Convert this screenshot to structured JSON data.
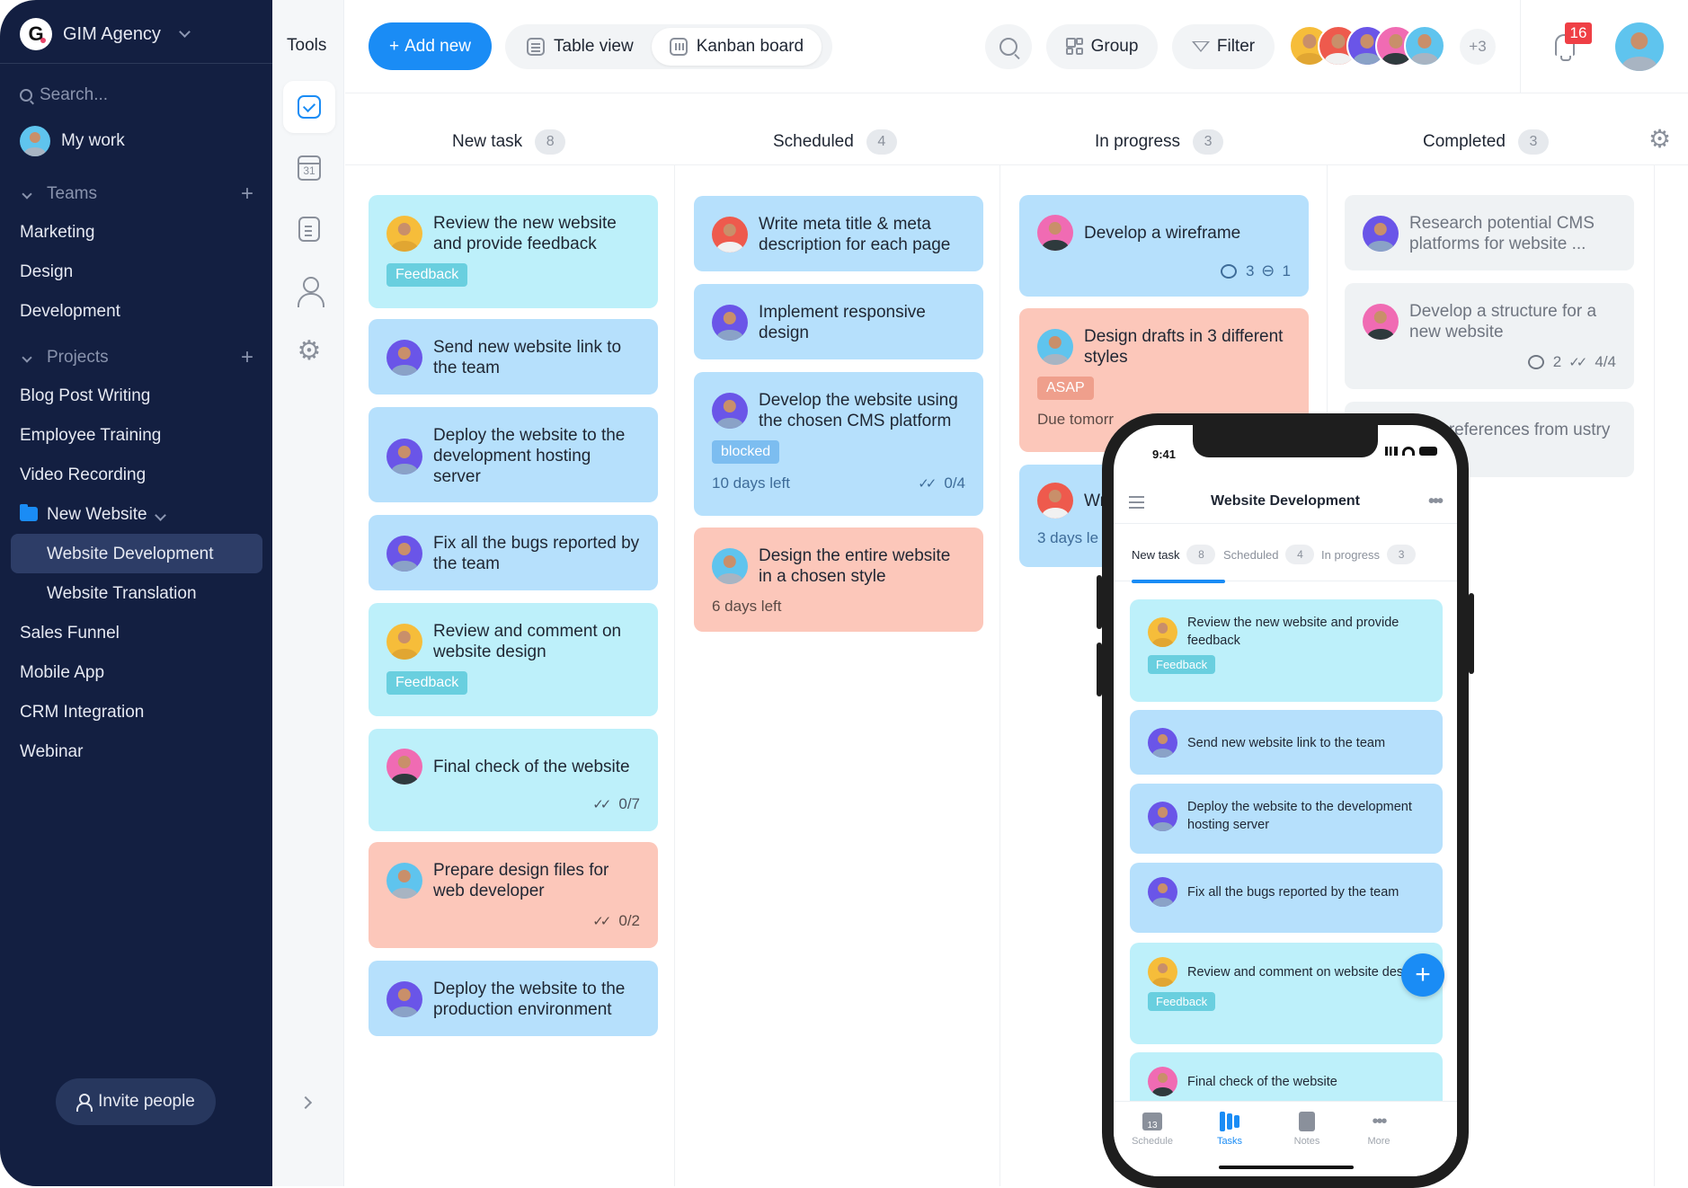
{
  "sidebar": {
    "workspace": "GIM Agency",
    "logo_letter": "G",
    "search_placeholder": "Search...",
    "my_work": "My work",
    "teams_label": "Teams",
    "teams": [
      "Marketing",
      "Design",
      "Development"
    ],
    "projects_label": "Projects",
    "projects": [
      "Blog Post Writing",
      "Employee Training",
      "Video Recording"
    ],
    "folder": {
      "label": "New Website",
      "children": [
        "Website Development",
        "Website Translation"
      ],
      "active": "Website Development"
    },
    "projects_after": [
      "Sales Funnel",
      "Mobile App",
      "CRM Integration",
      "Webinar"
    ],
    "invite": "Invite people"
  },
  "tools": {
    "title": "Tools",
    "items": [
      {
        "icon": "tasks-icon",
        "active": true
      },
      {
        "icon": "calendar-icon",
        "label": "31"
      },
      {
        "icon": "notes-icon"
      },
      {
        "icon": "user-icon"
      },
      {
        "icon": "settings-icon"
      }
    ]
  },
  "toolbar": {
    "add_new": "Add new",
    "views": [
      "Table view",
      "Kanban board"
    ],
    "active_view": "Kanban board",
    "group": "Group",
    "filter": "Filter",
    "member_overflow": "+3",
    "notifications": "16"
  },
  "columns": [
    {
      "name": "New task",
      "count": "8",
      "cards": [
        {
          "title": "Review the new website and provide feedback",
          "avatar": "yellow",
          "color": "cyan",
          "tag": "Feedback"
        },
        {
          "title": "Send new website link to the team",
          "avatar": "purple",
          "color": "blue"
        },
        {
          "title": "Deploy the website to the development hosting server",
          "avatar": "purple",
          "color": "blue"
        },
        {
          "title": "Fix all the bugs reported by the team",
          "avatar": "purple",
          "color": "blue"
        },
        {
          "title": "Review and comment on website design",
          "avatar": "yellow",
          "color": "cyan",
          "tag": "Feedback"
        },
        {
          "title": "Final check of the website",
          "avatar": "pink",
          "color": "cyan",
          "checklist": "0/7"
        },
        {
          "title": "Prepare design files for web developer",
          "avatar": "blue",
          "color": "salmon",
          "checklist": "0/2"
        },
        {
          "title": "Deploy the website to the production environment",
          "avatar": "purple",
          "color": "blue"
        }
      ]
    },
    {
      "name": "Scheduled",
      "count": "4",
      "cards": [
        {
          "title": "Write meta title & meta description for each page",
          "avatar": "red",
          "color": "blue"
        },
        {
          "title": "Implement responsive design",
          "avatar": "purple",
          "color": "blue"
        },
        {
          "title": "Develop the website using the chosen CMS platform",
          "avatar": "purple",
          "color": "blue",
          "tag": "blocked",
          "due": "10 days left",
          "checklist": "0/4"
        },
        {
          "title": "Design the entire website in a chosen style",
          "avatar": "blue",
          "color": "salmon",
          "due": "6 days left"
        }
      ]
    },
    {
      "name": "In progress",
      "count": "3",
      "cards": [
        {
          "title": "Develop a wireframe",
          "avatar": "pink",
          "color": "blue",
          "comments": "3",
          "attachments": "1"
        },
        {
          "title": "Design drafts in 3 different styles",
          "avatar": "blue",
          "color": "salmon",
          "tag": "ASAP",
          "due": "Due tomorr"
        },
        {
          "title": "Wr",
          "avatar": "red",
          "color": "blue",
          "due": "3 days le"
        }
      ]
    },
    {
      "name": "Completed",
      "count": "3",
      "cards": [
        {
          "title": "Research potential CMS platforms for website ...",
          "avatar": "purple",
          "color": "grey"
        },
        {
          "title": "Develop a structure for a new website",
          "avatar": "pink",
          "color": "grey",
          "comments": "2",
          "checklist": "4/4"
        },
        {
          "title": "0 references from ustry",
          "color": "grey"
        }
      ]
    }
  ],
  "phone": {
    "time": "9:41",
    "title": "Website Development",
    "tabs": [
      {
        "label": "New task",
        "count": "8",
        "active": true
      },
      {
        "label": "Scheduled",
        "count": "4"
      },
      {
        "label": "In progress",
        "count": "3"
      }
    ],
    "cards": [
      {
        "title": "Review the new website and provide feedback",
        "avatar": "yellow",
        "color": "cyan",
        "tag": "Feedback"
      },
      {
        "title": "Send new website link to the team",
        "avatar": "purple",
        "color": "blue"
      },
      {
        "title": "Deploy the website to the development hosting server",
        "avatar": "purple",
        "color": "blue"
      },
      {
        "title": "Fix all the bugs reported by the team",
        "avatar": "purple",
        "color": "blue"
      },
      {
        "title": "Review and comment on website design",
        "avatar": "yellow",
        "color": "cyan",
        "tag": "Feedback"
      },
      {
        "title": "Final check of the website",
        "avatar": "pink",
        "color": "cyan"
      }
    ],
    "bottom_nav": [
      {
        "label": "Schedule",
        "icon": "calendar-icon",
        "badge": "13"
      },
      {
        "label": "Tasks",
        "icon": "tasks-icon",
        "active": true
      },
      {
        "label": "Notes",
        "icon": "notes-icon"
      },
      {
        "label": "More",
        "icon": "more-icon"
      }
    ]
  },
  "colors": {
    "accent": "#1a8cf5",
    "sidebar_bg": "#131f41",
    "card_cyan": "#bdf0fa",
    "card_blue": "#b6e0fc",
    "card_salmon": "#fcc7ba",
    "card_grey": "#eff2f4",
    "badge_red": "#ef3f45"
  }
}
